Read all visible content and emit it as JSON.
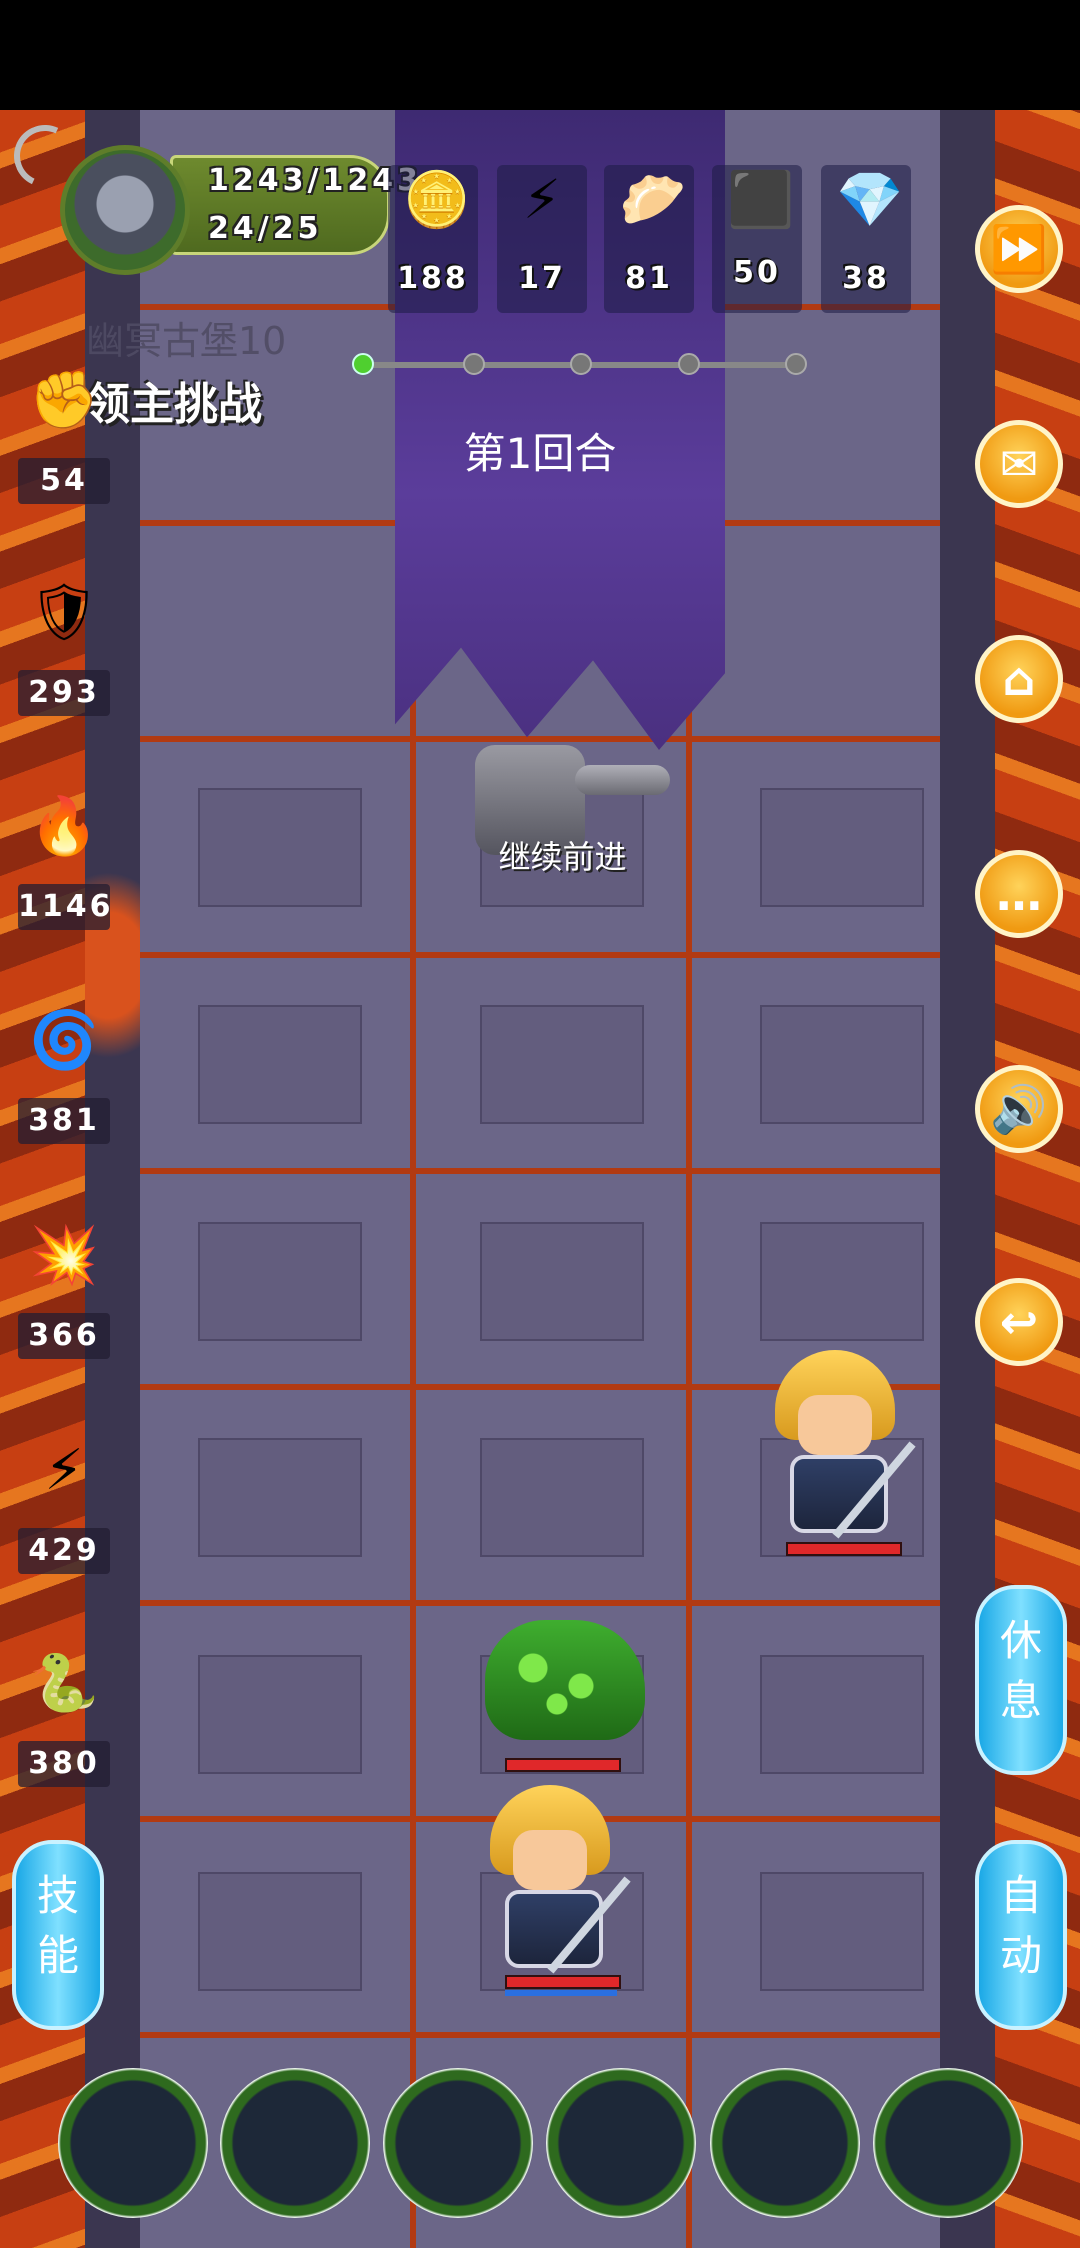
{
  "player": {
    "hp": "1243/1243",
    "energy": "24/25"
  },
  "resources": [
    {
      "icon": "gold-coin-icon",
      "glyph": "🪙",
      "value": "188"
    },
    {
      "icon": "lightning-icon",
      "glyph": "⚡",
      "value": "17"
    },
    {
      "icon": "dumpling-icon",
      "glyph": "🥟",
      "value": "81"
    },
    {
      "icon": "iron-ingot-icon",
      "glyph": "⬛",
      "value": "50"
    },
    {
      "icon": "crystal-icon",
      "glyph": "💎",
      "value": "38"
    }
  ],
  "location": "幽冥古堡10",
  "challenge": "领主挑战",
  "round": "第1回合",
  "continue_label": "继续前进",
  "stats": [
    {
      "icon": "fist-icon",
      "glyph": "✊",
      "value": "54"
    },
    {
      "icon": "shield-icon",
      "glyph": "🛡",
      "value": "293"
    },
    {
      "icon": "flame-arrow-icon",
      "glyph": "🔥",
      "value": "1146"
    },
    {
      "icon": "water-swirl-icon",
      "glyph": "🌀",
      "value": "381"
    },
    {
      "icon": "fire-burst-icon",
      "glyph": "💥",
      "value": "366"
    },
    {
      "icon": "lightning-bolt-purple-icon",
      "glyph": "⚡",
      "value": "429"
    },
    {
      "icon": "poison-snake-icon",
      "glyph": "🐍",
      "value": "380"
    }
  ],
  "right_buttons": [
    {
      "icon": "fast-forward-icon",
      "glyph": "⏩"
    },
    {
      "icon": "mail-icon",
      "glyph": "✉"
    },
    {
      "icon": "home-icon",
      "glyph": "⌂"
    },
    {
      "icon": "chat-icon",
      "glyph": "…"
    },
    {
      "icon": "sound-icon",
      "glyph": "🔊"
    },
    {
      "icon": "return-icon",
      "glyph": "↩"
    }
  ],
  "rest_label_1": "休",
  "rest_label_2": "息",
  "auto_label_1": "自",
  "auto_label_2": "动",
  "skill_label_1": "技",
  "skill_label_2": "能",
  "progress": {
    "current_stage": 1,
    "total_stages": 5
  }
}
